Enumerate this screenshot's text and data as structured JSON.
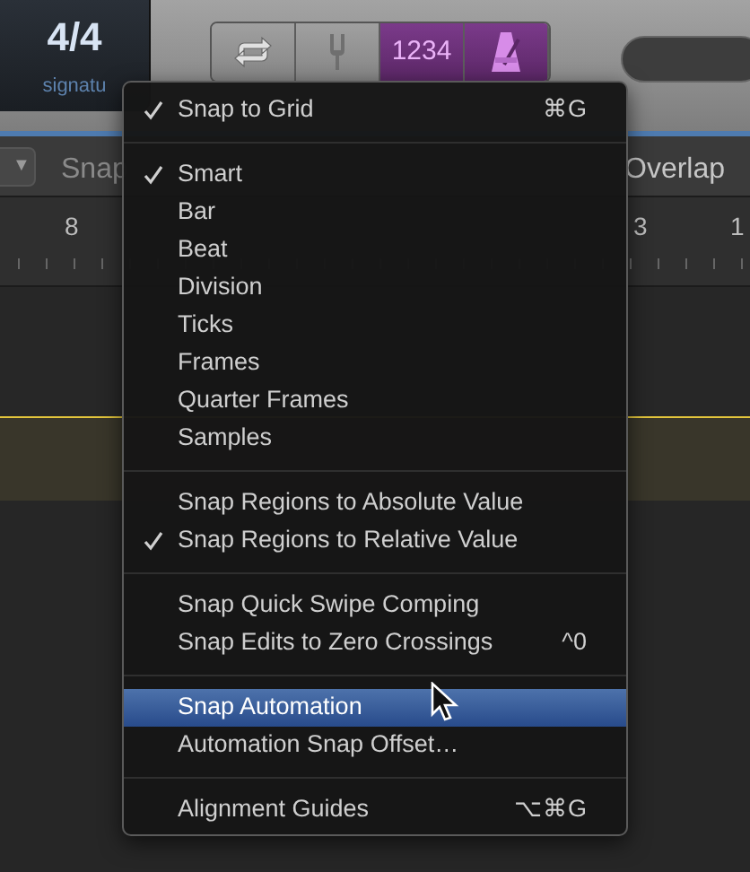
{
  "toolbar": {
    "signature_display": {
      "value": "4/4",
      "label": "signatu"
    },
    "buttons": [
      {
        "kind": "cycle",
        "selected": false
      },
      {
        "kind": "tuner",
        "selected": false
      },
      {
        "kind": "count_in",
        "label": "1234",
        "selected": true
      },
      {
        "kind": "metronome",
        "selected": true
      }
    ]
  },
  "tracks_header": {
    "dropdown": "▼",
    "snap_label": "Snap",
    "drag_label": "Overlap"
  },
  "ruler": {
    "bar_numbers": [
      "8",
      "3",
      "1"
    ]
  },
  "menu": {
    "sections": [
      [
        {
          "label": "Snap to Grid",
          "checked": true,
          "shortcut": "⌘G",
          "selected": false
        }
      ],
      [
        {
          "label": "Smart",
          "checked": true,
          "selected": false
        },
        {
          "label": "Bar",
          "checked": false,
          "selected": false
        },
        {
          "label": "Beat",
          "checked": false,
          "selected": false
        },
        {
          "label": "Division",
          "checked": false,
          "selected": false
        },
        {
          "label": "Ticks",
          "checked": false,
          "selected": false
        },
        {
          "label": "Frames",
          "checked": false,
          "selected": false
        },
        {
          "label": "Quarter Frames",
          "checked": false,
          "selected": false
        },
        {
          "label": "Samples",
          "checked": false,
          "selected": false
        }
      ],
      [
        {
          "label": "Snap Regions to Absolute Value",
          "checked": false,
          "selected": false
        },
        {
          "label": "Snap Regions to Relative Value",
          "checked": true,
          "selected": false
        }
      ],
      [
        {
          "label": "Snap Quick Swipe Comping",
          "checked": false,
          "selected": false
        },
        {
          "label": "Snap Edits to Zero Crossings",
          "checked": false,
          "shortcut": "^0",
          "selected": false
        }
      ],
      [
        {
          "label": "Snap Automation",
          "checked": false,
          "selected": true
        },
        {
          "label": "Automation Snap Offset…",
          "checked": false,
          "selected": false
        }
      ],
      [
        {
          "label": "Alignment Guides",
          "checked": false,
          "shortcut": "⌥⌘G",
          "selected": false
        }
      ]
    ]
  }
}
